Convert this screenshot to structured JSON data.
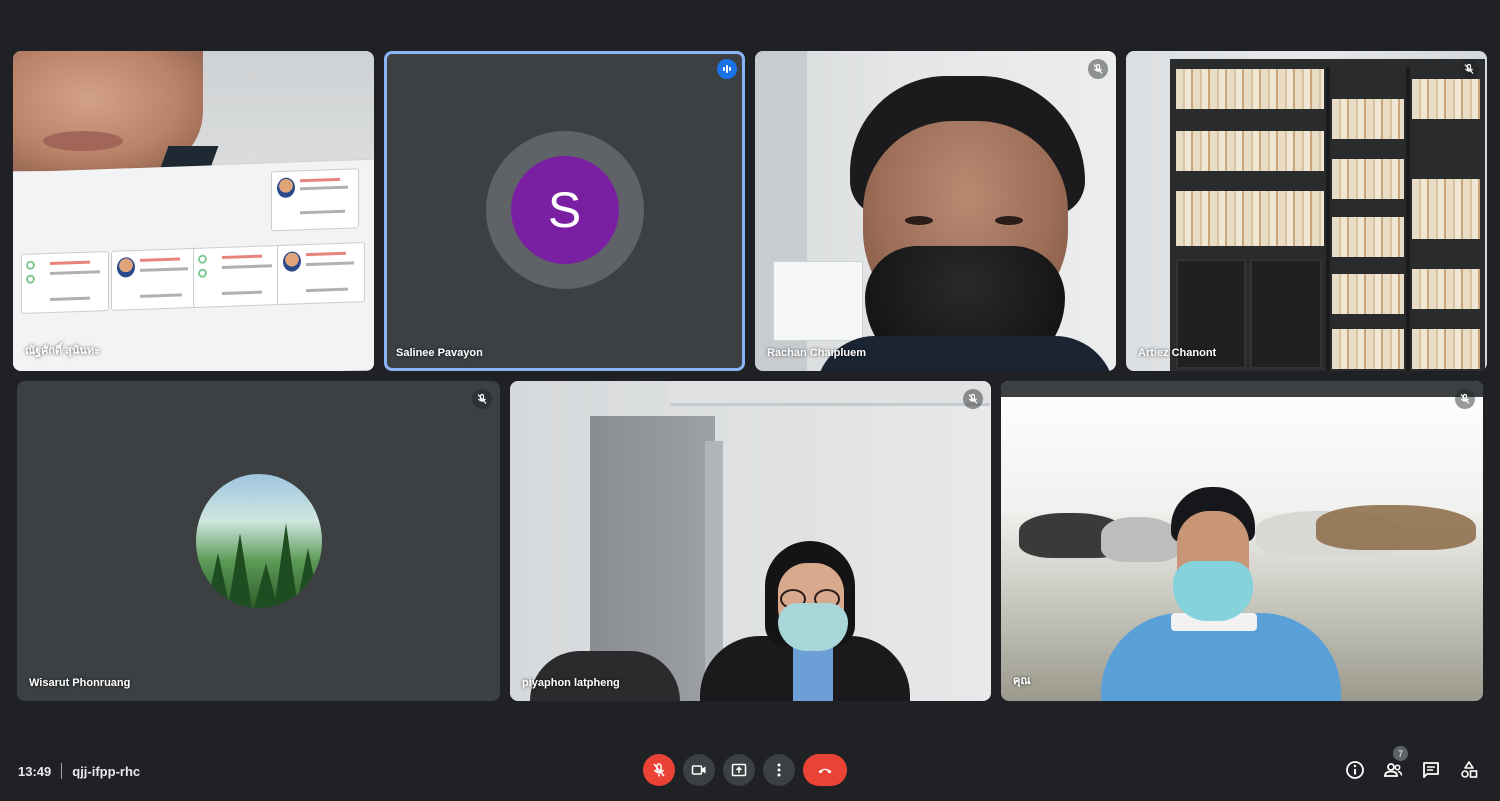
{
  "meeting": {
    "time": "13:49",
    "code": "qjj-ifpp-rhc",
    "participant_count": "7"
  },
  "participants": [
    {
      "name": "ณัฐศักดิ์ สุนันทะ",
      "muted": false,
      "speaking": false
    },
    {
      "name": "Salinee Pavayon",
      "muted": false,
      "speaking": true,
      "avatar_letter": "S",
      "avatar_color": "#7b1fa2"
    },
    {
      "name": "Rachan Chaipluem",
      "muted": true,
      "speaking": false
    },
    {
      "name": "Artiez Chanont",
      "muted": true,
      "speaking": false
    },
    {
      "name": "Wisarut Phonruang",
      "muted": true,
      "speaking": false
    },
    {
      "name": "piyaphon latpheng",
      "muted": true,
      "speaking": false
    },
    {
      "name": "คุณ",
      "muted": true,
      "speaking": false
    }
  ],
  "controls": {
    "mic": "mic-off-icon",
    "camera": "camera-icon",
    "present": "present-screen-icon",
    "more": "more-vert-icon",
    "hangup": "call-end-icon"
  },
  "colors": {
    "background": "#202124",
    "tile": "#3c4043",
    "speaking_outline": "#8ab4f8",
    "danger": "#ea4335"
  }
}
